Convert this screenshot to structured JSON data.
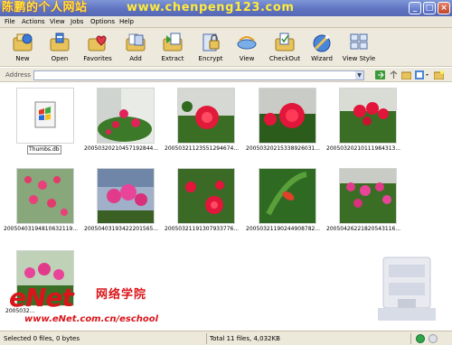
{
  "window": {
    "title": "陈鹏的个人网站",
    "url": "www.chenpeng123.com"
  },
  "menu": [
    "File",
    "Actions",
    "View",
    "Jobs",
    "Options",
    "Help"
  ],
  "toolbar": [
    {
      "label": "New",
      "icon": "new-icon"
    },
    {
      "label": "Open",
      "icon": "open-icon"
    },
    {
      "label": "Favorites",
      "icon": "favorites-icon"
    },
    {
      "label": "Add",
      "icon": "add-icon"
    },
    {
      "label": "Extract",
      "icon": "extract-icon"
    },
    {
      "label": "Encrypt",
      "icon": "encrypt-icon"
    },
    {
      "label": "View",
      "icon": "view-icon"
    },
    {
      "label": "CheckOut",
      "icon": "checkout-icon"
    },
    {
      "label": "Wizard",
      "icon": "wizard-icon"
    },
    {
      "label": "View Style",
      "icon": "view-style-icon"
    }
  ],
  "address": {
    "label": "Address",
    "value": ""
  },
  "files": [
    {
      "name": "Thumbs.db"
    },
    {
      "name": "20050320210457192844..."
    },
    {
      "name": "20050321123551294674..."
    },
    {
      "name": "20050320215338926031..."
    },
    {
      "name": "20050320210111984313..."
    },
    {
      "name": "20050403194810632119..."
    },
    {
      "name": "20050403193422201565..."
    },
    {
      "name": "20050321191307933776..."
    },
    {
      "name": "20050321190244908782..."
    },
    {
      "name": "20050426221820543116..."
    },
    {
      "name": "2005032..."
    }
  ],
  "watermark": {
    "brand": "eNet",
    "chinese": "网络学院",
    "url": "www.eNet.com.cn/eschool"
  },
  "status": {
    "selected": "Selected 0 files, 0 bytes",
    "total": "Total 11 files, 4,032KB"
  },
  "colors": {
    "titlebar": "#6178c8",
    "accent_red": "#d9151b",
    "title_text": "#ffeb3b"
  }
}
